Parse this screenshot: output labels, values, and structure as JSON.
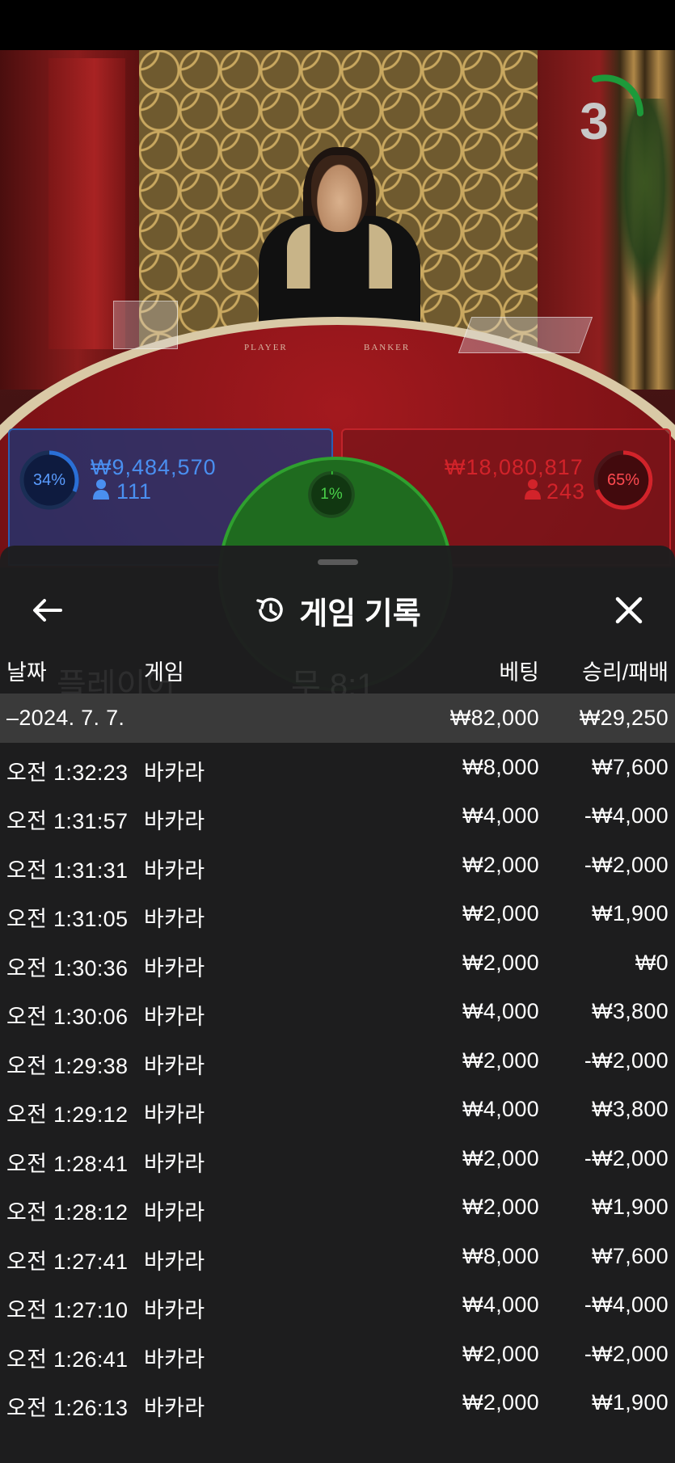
{
  "scene": {
    "countdown": "3",
    "table_labels": {
      "player": "PLAYER",
      "banker": "BANKER"
    }
  },
  "bets": {
    "player": {
      "percent": "34%",
      "amount": "₩9,484,570",
      "players": "111"
    },
    "tie": {
      "percent": "1%"
    },
    "banker": {
      "percent": "65%",
      "amount": "₩18,080,817",
      "players": "243"
    }
  },
  "history": {
    "title": "게임 기록",
    "columns": {
      "date": "날짜",
      "game": "게임",
      "bet": "베팅",
      "winloss": "승리/패배"
    },
    "summary": {
      "date": "–2024. 7. 7.",
      "bet": "₩82,000",
      "winloss": "₩29,250"
    },
    "rows": [
      {
        "time": "오전 1:32:23",
        "game": "바카라",
        "bet": "₩8,000",
        "winloss": "₩7,600"
      },
      {
        "time": "오전 1:31:57",
        "game": "바카라",
        "bet": "₩4,000",
        "winloss": "-₩4,000"
      },
      {
        "time": "오전 1:31:31",
        "game": "바카라",
        "bet": "₩2,000",
        "winloss": "-₩2,000"
      },
      {
        "time": "오전 1:31:05",
        "game": "바카라",
        "bet": "₩2,000",
        "winloss": "₩1,900"
      },
      {
        "time": "오전 1:30:36",
        "game": "바카라",
        "bet": "₩2,000",
        "winloss": "₩0"
      },
      {
        "time": "오전 1:30:06",
        "game": "바카라",
        "bet": "₩4,000",
        "winloss": "₩3,800"
      },
      {
        "time": "오전 1:29:38",
        "game": "바카라",
        "bet": "₩2,000",
        "winloss": "-₩2,000"
      },
      {
        "time": "오전 1:29:12",
        "game": "바카라",
        "bet": "₩4,000",
        "winloss": "₩3,800"
      },
      {
        "time": "오전 1:28:41",
        "game": "바카라",
        "bet": "₩2,000",
        "winloss": "-₩2,000"
      },
      {
        "time": "오전 1:28:12",
        "game": "바카라",
        "bet": "₩2,000",
        "winloss": "₩1,900"
      },
      {
        "time": "오전 1:27:41",
        "game": "바카라",
        "bet": "₩8,000",
        "winloss": "₩7,600"
      },
      {
        "time": "오전 1:27:10",
        "game": "바카라",
        "bet": "₩4,000",
        "winloss": "-₩4,000"
      },
      {
        "time": "오전 1:26:41",
        "game": "바카라",
        "bet": "₩2,000",
        "winloss": "-₩2,000"
      },
      {
        "time": "오전 1:26:13",
        "game": "바카라",
        "bet": "₩2,000",
        "winloss": "₩1,900"
      }
    ]
  },
  "icons": {
    "back": "arrow-left-icon",
    "history": "history-clock-icon",
    "close": "close-icon",
    "player_count": "person-icon"
  },
  "colors": {
    "player": "#2a6fd6",
    "banker": "#d2232a",
    "tie": "#2fa02f",
    "sheet": "#1e1e1f",
    "summary_row": "#3a3a3a"
  }
}
